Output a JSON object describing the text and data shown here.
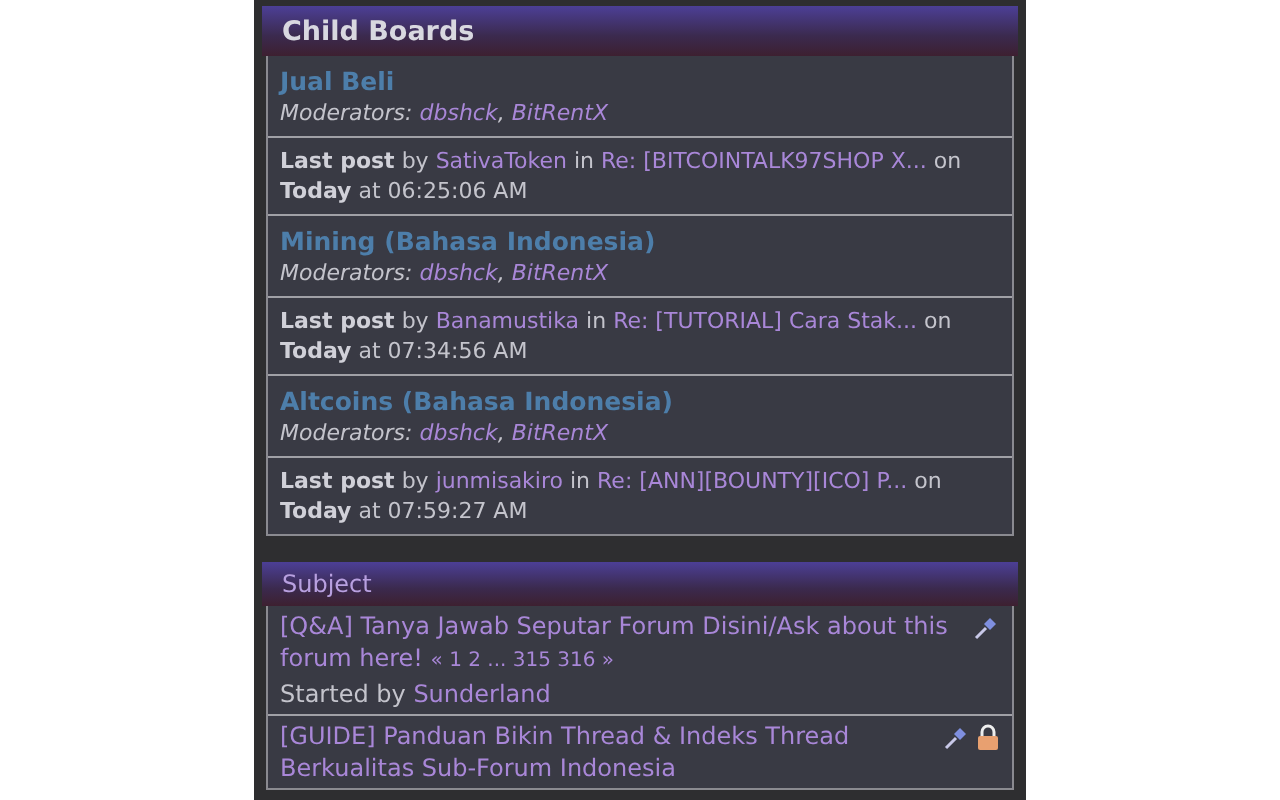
{
  "child_boards": {
    "title": "Child Boards",
    "rows": [
      {
        "kind": "board",
        "name": "Jual Beli",
        "moderators_label": "Moderators:",
        "separator": ",",
        "moderators": [
          "dbshck",
          "BitRentX"
        ]
      },
      {
        "kind": "lastpost",
        "label": "Last post",
        "by": "by",
        "user": "SativaToken",
        "in": "in",
        "topic": "Re: [BITCOINTALK97SHOP X...",
        "on": "on",
        "day": "Today",
        "time": "at 06:25:06 AM"
      },
      {
        "kind": "board",
        "name": "Mining (Bahasa Indonesia)",
        "moderators_label": "Moderators:",
        "separator": ",",
        "moderators": [
          "dbshck",
          "BitRentX"
        ]
      },
      {
        "kind": "lastpost",
        "label": "Last post",
        "by": "by",
        "user": "Banamustika",
        "in": "in",
        "topic": "Re: [TUTORIAL] Cara Stak...",
        "on": "on",
        "day": "Today",
        "time": "at 07:34:56 AM"
      },
      {
        "kind": "board",
        "name": "Altcoins (Bahasa Indonesia)",
        "moderators_label": "Moderators:",
        "separator": ",",
        "moderators": [
          "dbshck",
          "BitRentX"
        ]
      },
      {
        "kind": "lastpost",
        "label": "Last post",
        "by": "by",
        "user": "junmisakiro",
        "in": "in",
        "topic": "Re: [ANN][BOUNTY][ICO] P...",
        "on": "on",
        "day": "Today",
        "time": "at 07:59:27 AM"
      }
    ]
  },
  "topics": {
    "column": "Subject",
    "rows": [
      {
        "title": "[Q&A] Tanya Jawab Seputar Forum Disini/Ask about this forum here!",
        "pages": "« 1 2 ... 315 316 »",
        "started_label": "Started by",
        "starter": "Sunderland",
        "sticky": true,
        "locked": false
      },
      {
        "title": "[GUIDE] Panduan Bikin Thread & Indeks Thread Berkualitas Sub-Forum Indonesia",
        "sticky": true,
        "locked": true
      }
    ]
  }
}
